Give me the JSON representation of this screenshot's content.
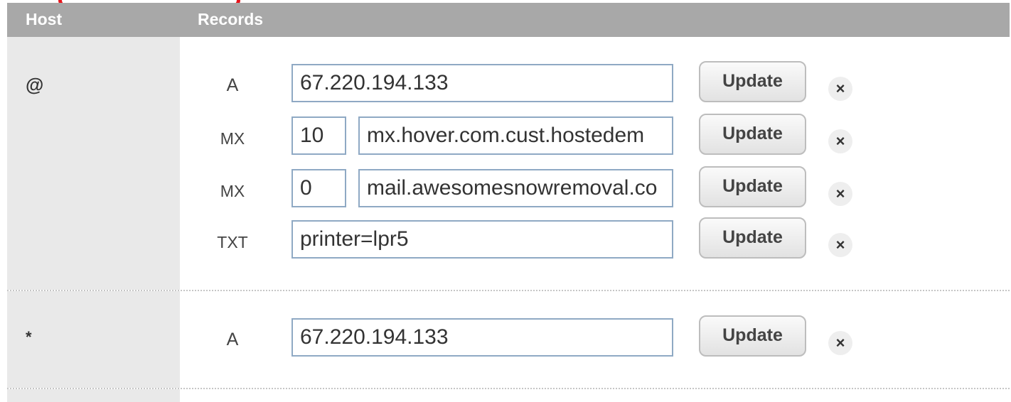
{
  "header": {
    "host_label": "Host",
    "records_label": "Records"
  },
  "groups": [
    {
      "host": "@",
      "records": [
        {
          "type": "A",
          "value": "67.220.194.133",
          "update_label": "Update",
          "delete_icon": "×"
        },
        {
          "type": "MX",
          "priority": "10",
          "value": "mx.hover.com.cust.hostedem",
          "update_label": "Update",
          "delete_icon": "×"
        },
        {
          "type": "MX",
          "priority": "0",
          "value": "mail.awesomesnowremoval.co",
          "update_label": "Update",
          "delete_icon": "×"
        },
        {
          "type": "TXT",
          "value": "printer=lpr5",
          "update_label": "Update",
          "delete_icon": "×"
        }
      ]
    },
    {
      "host": "*",
      "records": [
        {
          "type": "A",
          "value": "67.220.194.133",
          "update_label": "Update",
          "delete_icon": "×"
        }
      ]
    }
  ],
  "colors": {
    "header_bg": "#a8a8a8",
    "host_cell_bg": "#e9e9e9",
    "input_border": "#8fa9c4",
    "highlight": "#e8141b"
  }
}
